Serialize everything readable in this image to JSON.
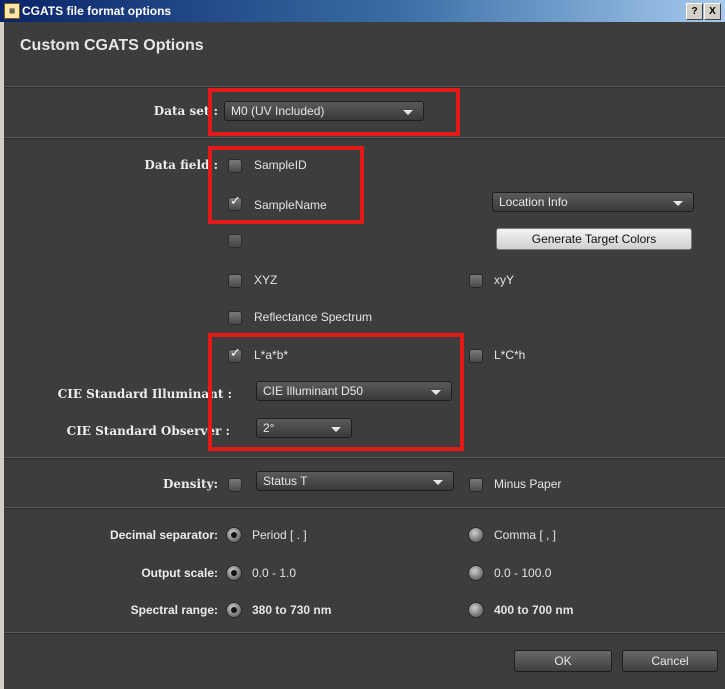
{
  "window": {
    "title": "CGATS file format options",
    "help_btn": "?",
    "close_btn": "X"
  },
  "header": "Custom CGATS Options",
  "data_set": {
    "label": "Data set :",
    "value": "M0 (UV Included)"
  },
  "data_fields": {
    "label": "Data field :",
    "sample_id": {
      "label": "SampleID",
      "checked": false
    },
    "sample_name": {
      "label": "SampleName",
      "checked": true
    },
    "unlabeled": {
      "checked": false
    },
    "location_dropdown": "Location Info",
    "generate_button": "Generate Target Colors",
    "xyz": {
      "label": "XYZ",
      "checked": false
    },
    "xyy": {
      "label": "xyY",
      "checked": false
    },
    "reflectance": {
      "label": "Reflectance Spectrum",
      "checked": false
    },
    "lab": {
      "label": "L*a*b*",
      "checked": true
    },
    "lch": {
      "label": "L*C*h",
      "checked": false
    }
  },
  "illuminant": {
    "label": "CIE Standard Illuminant :",
    "value": "CIE Illuminant D50"
  },
  "observer": {
    "label": "CIE Standard Observer :",
    "value": "2°"
  },
  "density": {
    "label": "Density:",
    "checked": false,
    "value": "Status T",
    "minus_paper": "Minus Paper",
    "minus_paper_checked": false
  },
  "decimal": {
    "label": "Decimal separator:",
    "opt1": "Period [ . ]",
    "opt2": "Comma [ , ]",
    "selected": "opt1"
  },
  "output_scale": {
    "label": "Output scale:",
    "opt1": "0.0 - 1.0",
    "opt2": "0.0 - 100.0",
    "selected": "opt1"
  },
  "spectral": {
    "label": "Spectral range:",
    "opt1": "380 to 730 nm",
    "opt2": "400 to 700 nm",
    "selected": "opt1"
  },
  "footer": {
    "ok": "OK",
    "cancel": "Cancel"
  },
  "colors": {
    "highlight": "#e41a1a",
    "panel": "#3d3d3d"
  }
}
